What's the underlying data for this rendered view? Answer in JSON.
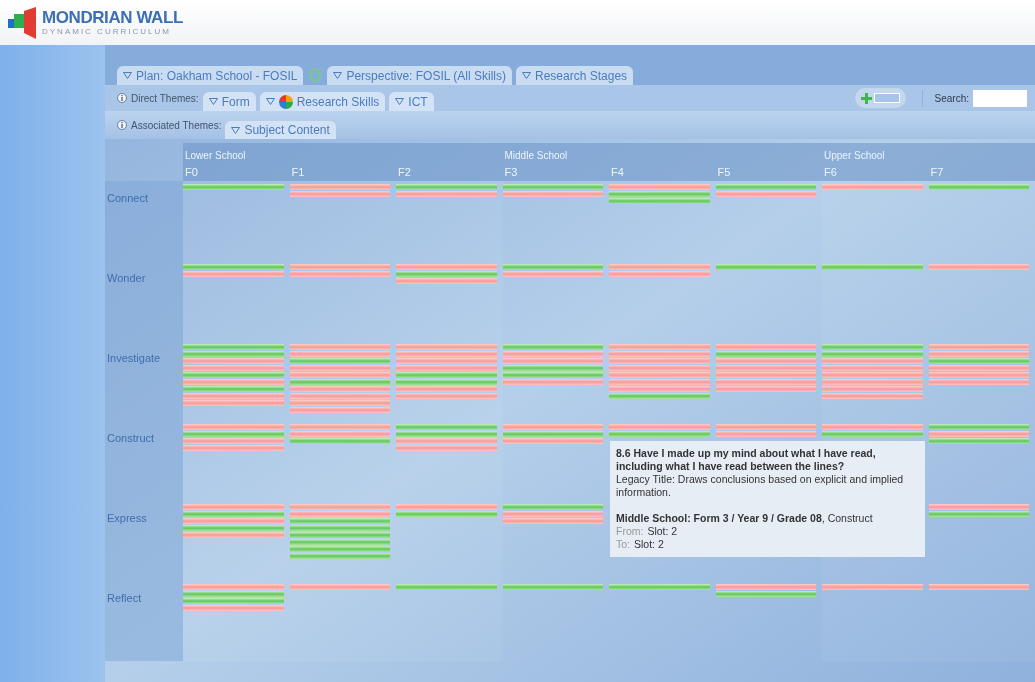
{
  "header": {
    "title": "MONDRIAN WALL",
    "subtitle": "DYNAMIC CURRICULUM"
  },
  "plan_tabs": [
    {
      "kind": "tab",
      "label": "Plan: Oakham School - FOSIL"
    },
    {
      "kind": "refresh"
    },
    {
      "kind": "tab",
      "label": "Perspective: FOSIL (All Skills)"
    },
    {
      "kind": "tab",
      "label": "Research Stages"
    }
  ],
  "direct_themes": {
    "label": "Direct Themes:",
    "tabs": [
      {
        "label": "Form",
        "kind": "plain"
      },
      {
        "label": "Research Skills",
        "kind": "pie"
      },
      {
        "label": "ICT",
        "kind": "plain"
      }
    ]
  },
  "associated_themes": {
    "label": "Associated Themes:",
    "tabs": [
      {
        "label": "Subject Content"
      }
    ]
  },
  "search": {
    "label": "Search:"
  },
  "groups": [
    {
      "label": "Lower School",
      "columns": [
        "F0",
        "F1",
        "F2"
      ]
    },
    {
      "label": "Middle School",
      "columns": [
        "F3",
        "F4",
        "F5"
      ]
    },
    {
      "label": "Upper School",
      "columns": [
        "F6",
        "F7"
      ]
    }
  ],
  "rows": [
    {
      "label": "Connect",
      "cells": [
        [
          {
            "met": true
          }
        ],
        [
          {
            "met": false
          },
          {
            "met": false
          }
        ],
        [
          {
            "met": true
          },
          {
            "met": false
          }
        ],
        [
          {
            "met": true
          },
          {
            "met": false
          }
        ],
        [
          {
            "met": false
          },
          {
            "met": true
          },
          {
            "met": true
          }
        ],
        [
          {
            "met": true
          },
          {
            "met": false
          }
        ],
        [
          {
            "met": false
          }
        ],
        [
          {
            "met": true
          }
        ]
      ]
    },
    {
      "label": "Wonder",
      "cells": [
        [
          {
            "met": true
          },
          {
            "met": false
          }
        ],
        [
          {
            "met": false
          },
          {
            "met": false
          }
        ],
        [
          {
            "met": false
          },
          {
            "met": true
          },
          {
            "met": false
          }
        ],
        [
          {
            "met": true
          },
          {
            "met": false
          }
        ],
        [
          {
            "met": false
          },
          {
            "met": false
          }
        ],
        [
          {
            "met": true
          }
        ],
        [
          {
            "met": true
          }
        ],
        [
          {
            "met": false
          }
        ]
      ]
    },
    {
      "label": "Investigate",
      "cells": [
        [
          {
            "met": true
          },
          {
            "met": true
          },
          {
            "met": false
          },
          {
            "met": false
          },
          {
            "met": true
          },
          {
            "met": false
          },
          {
            "met": true
          },
          {
            "met": false
          },
          {
            "met": false
          }
        ],
        [
          {
            "met": false
          },
          {
            "met": false
          },
          {
            "met": true
          },
          {
            "met": false
          },
          {
            "met": false
          },
          {
            "met": true
          },
          {
            "met": false
          },
          {
            "met": false
          },
          {
            "met": false
          },
          {
            "met": false
          }
        ],
        [
          {
            "met": false
          },
          {
            "met": false
          },
          {
            "met": false
          },
          {
            "met": false
          },
          {
            "met": true
          },
          {
            "met": true
          },
          {
            "met": false
          },
          {
            "met": false
          }
        ],
        [
          {
            "met": true
          },
          {
            "met": false
          },
          {
            "met": false
          },
          {
            "met": true
          },
          {
            "met": true
          },
          {
            "met": false
          }
        ],
        [
          {
            "met": false
          },
          {
            "met": false
          },
          {
            "met": false
          },
          {
            "met": false
          },
          {
            "met": false
          },
          {
            "met": false
          },
          {
            "met": false
          },
          {
            "met": true
          }
        ],
        [
          {
            "met": false
          },
          {
            "met": true
          },
          {
            "met": false
          },
          {
            "met": false
          },
          {
            "met": false
          },
          {
            "met": false
          },
          {
            "met": false
          }
        ],
        [
          {
            "met": true
          },
          {
            "met": true
          },
          {
            "met": false
          },
          {
            "met": false
          },
          {
            "met": false
          },
          {
            "met": false
          },
          {
            "met": false
          },
          {
            "met": false
          }
        ],
        [
          {
            "met": false
          },
          {
            "met": false
          },
          {
            "met": true
          },
          {
            "met": false
          },
          {
            "met": false
          },
          {
            "met": false
          }
        ]
      ]
    },
    {
      "label": "Construct",
      "cells": [
        [
          {
            "met": false
          },
          {
            "met": true
          },
          {
            "met": false
          },
          {
            "met": false
          }
        ],
        [
          {
            "met": false
          },
          {
            "met": false
          },
          {
            "met": true
          }
        ],
        [
          {
            "met": true
          },
          {
            "met": true
          },
          {
            "met": false
          },
          {
            "met": false
          }
        ],
        [
          {
            "met": false
          },
          {
            "met": true
          },
          {
            "met": false
          }
        ],
        [
          {
            "met": false
          },
          {
            "met": true
          }
        ],
        [
          {
            "met": false
          },
          {
            "met": false
          }
        ],
        [
          {
            "met": false
          },
          {
            "met": true
          }
        ],
        [
          {
            "met": true
          },
          {
            "met": false
          },
          {
            "met": true
          }
        ]
      ]
    },
    {
      "label": "Express",
      "cells": [
        [
          {
            "met": false
          },
          {
            "met": true
          },
          {
            "met": false
          },
          {
            "met": true
          },
          {
            "met": false
          }
        ],
        [
          {
            "met": false
          },
          {
            "met": false
          },
          {
            "met": true
          },
          {
            "met": true
          },
          {
            "met": true
          },
          {
            "met": true
          },
          {
            "met": true
          },
          {
            "met": true
          }
        ],
        [
          {
            "met": false
          },
          {
            "met": true
          }
        ],
        [
          {
            "met": true
          },
          {
            "met": false
          },
          {
            "met": false
          }
        ],
        null,
        null,
        null,
        [
          {
            "met": false
          },
          {
            "met": true
          }
        ]
      ]
    },
    {
      "label": "Reflect",
      "cells": [
        [
          {
            "met": false
          },
          {
            "met": true
          },
          {
            "met": true
          },
          {
            "met": false
          }
        ],
        [
          {
            "met": false
          }
        ],
        [
          {
            "met": true
          }
        ],
        [
          {
            "met": true
          }
        ],
        [
          {
            "met": true
          }
        ],
        [
          {
            "met": false
          },
          {
            "met": true
          }
        ],
        [
          {
            "met": false
          }
        ],
        [
          {
            "met": false
          }
        ]
      ]
    }
  ],
  "tooltip": {
    "title": "8.6 Have I made up my mind about what I have read, including what I have read between the lines?",
    "legacy": "Legacy Title: Draws conclusions based on explicit and implied information.",
    "place": "Middle School: Form 3 / Year 9 / Grade 08",
    "stage": ", Construct",
    "from_label": "From:",
    "from_value": "Slot: 2",
    "to_label": "To:",
    "to_value": "Slot: 2"
  }
}
